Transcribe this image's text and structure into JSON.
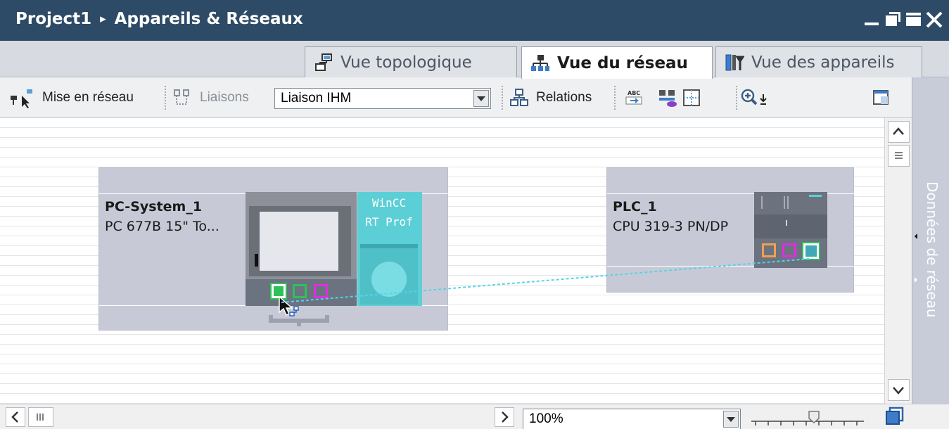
{
  "window": {
    "project": "Project1",
    "title": "Appareils & Réseaux",
    "breadcrumb_arrow": "▸",
    "controls": [
      "minimize-icon",
      "restore-icon",
      "maximize-icon",
      "close-icon"
    ]
  },
  "tabs": [
    {
      "label": "Vue topologique",
      "icon": "topology-icon",
      "active": false
    },
    {
      "label": "Vue du réseau",
      "icon": "network-icon",
      "active": true
    },
    {
      "label": "Vue des appareils",
      "icon": "devices-icon",
      "active": false
    }
  ],
  "toolbar": {
    "network_label": "Mise en réseau",
    "connections_label": "Liaisons",
    "connection_type": "Liaison IHM",
    "relations_label": "Relations"
  },
  "devices": [
    {
      "name": "PC-System_1",
      "type": "PC 677B 15\" To...",
      "module_line1": "WinCC",
      "module_line2": "RT Prof"
    },
    {
      "name": "PLC_1",
      "type": "CPU 319-3 PN/DP"
    }
  ],
  "side_panel": {
    "label": "Données de réseau"
  },
  "status": {
    "zoom": "100%"
  },
  "colors": {
    "titlebar": "#2d4b66",
    "device_bg": "#c7cad6",
    "connection_line": "#55d3e8",
    "port_green": "#2ec15a",
    "port_magenta": "#e02de0",
    "port_orange": "#f0a050",
    "wincc_module": "#5ccfd6"
  }
}
